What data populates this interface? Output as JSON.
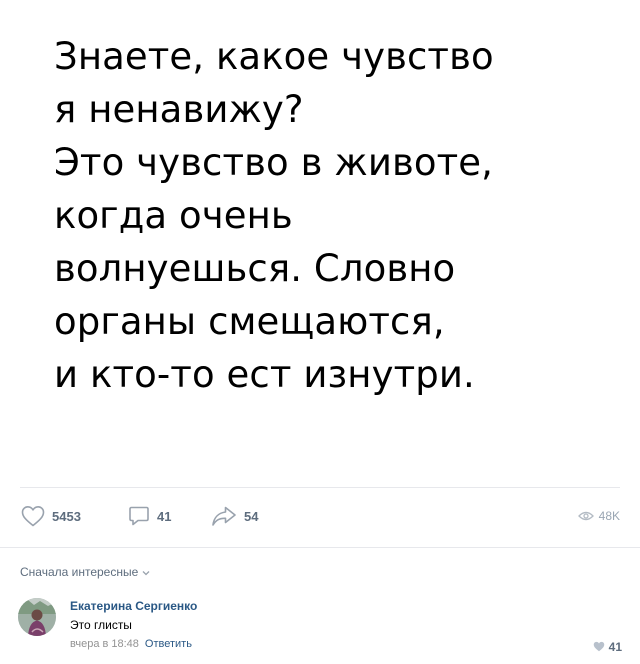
{
  "post": {
    "text_lines": [
      "Знаете, какое чувство",
      "я ненавижу?",
      "Это чувство в животе,",
      "когда очень",
      "волнуешься. Словно",
      "органы смещаются,",
      "и кто-то ест изнутри."
    ]
  },
  "actions": {
    "likes": "5453",
    "comments": "41",
    "shares": "54",
    "views": "48K"
  },
  "comments_section": {
    "sort_label": "Сначала интересные",
    "items": [
      {
        "author": "Екатерина Сергиенко",
        "text": "Это глисты",
        "time": "вчера в 18:48",
        "reply_label": "Ответить",
        "likes": "41"
      }
    ]
  },
  "icons": {
    "like": "heart-outline-icon",
    "comment": "speech-bubble-icon",
    "share": "share-arrow-icon",
    "views": "eye-icon",
    "sort": "chevron-down-icon",
    "comment_like": "heart-filled-icon"
  },
  "colors": {
    "link": "#2a5885",
    "icon": "#99a2ad",
    "count": "#5e6d7e",
    "muted": "#939393"
  }
}
